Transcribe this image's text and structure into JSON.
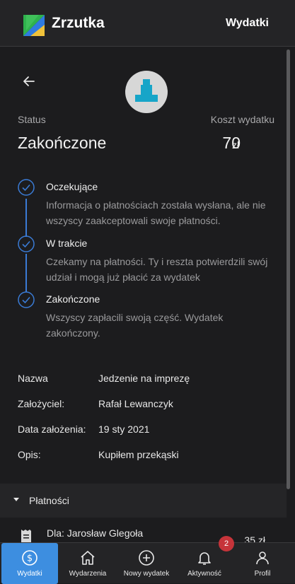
{
  "appbar": {
    "brand": "Zrzutka",
    "action": "Wydatki"
  },
  "header": {
    "status_label": "Status",
    "status_value": "Zakończone",
    "cost_label": "Koszt wydatku",
    "cost_value": "70",
    "cost_unit": "zł"
  },
  "steps": [
    {
      "title": "Oczekujące",
      "desc": "Informacja o płatnościach została wysłana, ale nie wszyscy zaakceptowali swoje płatności."
    },
    {
      "title": "W trakcie",
      "desc": "Czekamy na płatności. Ty i reszta potwierdzili swój udział i mogą już płacić za wydatek"
    },
    {
      "title": "Zakończone",
      "desc": "Wszyscy zapłacili swoją część. Wydatek zakończony."
    }
  ],
  "details": [
    {
      "key": "Nazwa",
      "value": "Jedzenie na imprezę"
    },
    {
      "key": "Założyciel:",
      "value": "Rafał Lewanczyk"
    },
    {
      "key": "Data założenia:",
      "value": "19 sty 2021"
    },
    {
      "key": "Opis:",
      "value": "Kupiłem przekąski"
    }
  ],
  "payments": {
    "label": "Płatności",
    "rows": [
      {
        "who": "Dla: Jarosław Glegoła",
        "amount": "35 zł"
      }
    ]
  },
  "nav": {
    "items": [
      {
        "label": "Wydatki",
        "icon": "dollar-circle-icon"
      },
      {
        "label": "Wydarzenia",
        "icon": "home-icon"
      },
      {
        "label": "Nowy wydatek",
        "icon": "plus-circle-icon"
      },
      {
        "label": "Aktywność",
        "icon": "bell-icon"
      },
      {
        "label": "Profil",
        "icon": "person-icon"
      }
    ],
    "badge": "2"
  },
  "colors": {
    "accent": "#3d8ee0",
    "check": "#3a7bd5",
    "badge": "#c6343a",
    "avatar_glyph": "#17a5c8"
  }
}
